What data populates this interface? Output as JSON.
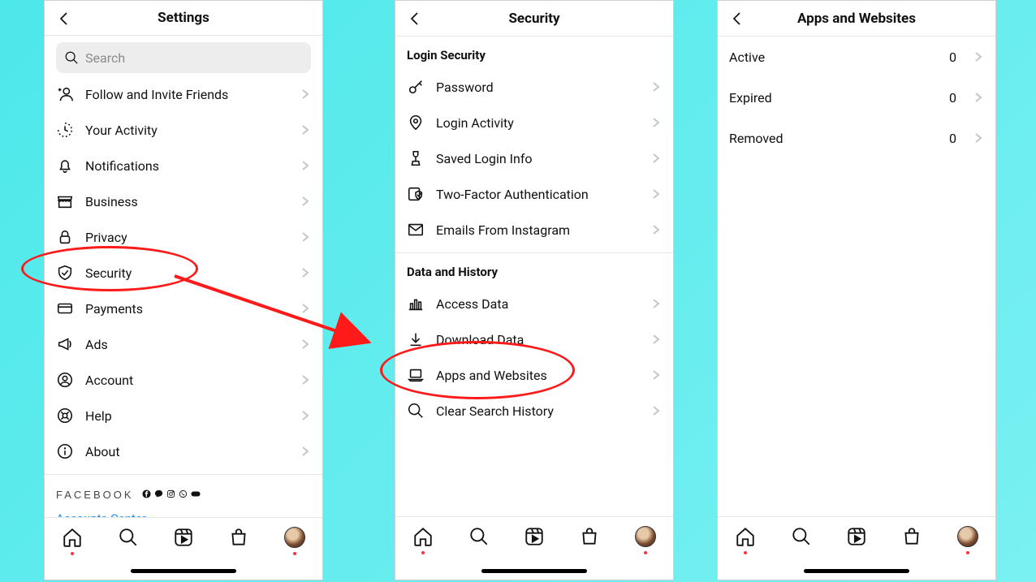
{
  "screen1": {
    "title": "Settings",
    "search_placeholder": "Search",
    "items": [
      {
        "icon": "add-user-icon",
        "label": "Follow and Invite Friends"
      },
      {
        "icon": "activity-icon",
        "label": "Your Activity"
      },
      {
        "icon": "bell-icon",
        "label": "Notifications"
      },
      {
        "icon": "store-icon",
        "label": "Business"
      },
      {
        "icon": "lock-icon",
        "label": "Privacy"
      },
      {
        "icon": "shield-icon",
        "label": "Security"
      },
      {
        "icon": "card-icon",
        "label": "Payments"
      },
      {
        "icon": "megaphone-icon",
        "label": "Ads"
      },
      {
        "icon": "account-icon",
        "label": "Account"
      },
      {
        "icon": "help-icon",
        "label": "Help"
      },
      {
        "icon": "info-icon",
        "label": "About"
      }
    ],
    "facebook_label": "FACEBOOK",
    "accounts_center": "Accounts Center"
  },
  "screen2": {
    "title": "Security",
    "section1": "Login Security",
    "items1": [
      {
        "icon": "key-icon",
        "label": "Password"
      },
      {
        "icon": "pin-icon",
        "label": "Login Activity"
      },
      {
        "icon": "keyhole-icon",
        "label": "Saved Login Info"
      },
      {
        "icon": "twofa-icon",
        "label": "Two-Factor Authentication"
      },
      {
        "icon": "mail-icon",
        "label": "Emails From Instagram"
      }
    ],
    "section2": "Data and History",
    "items2": [
      {
        "icon": "bar-icon",
        "label": "Access Data"
      },
      {
        "icon": "download-icon",
        "label": "Download Data"
      },
      {
        "icon": "laptop-icon",
        "label": "Apps and Websites"
      },
      {
        "icon": "searchclr-icon",
        "label": "Clear Search History"
      }
    ]
  },
  "screen3": {
    "title": "Apps and Websites",
    "rows": [
      {
        "label": "Active",
        "value": "0"
      },
      {
        "label": "Expired",
        "value": "0"
      },
      {
        "label": "Removed",
        "value": "0"
      }
    ]
  }
}
